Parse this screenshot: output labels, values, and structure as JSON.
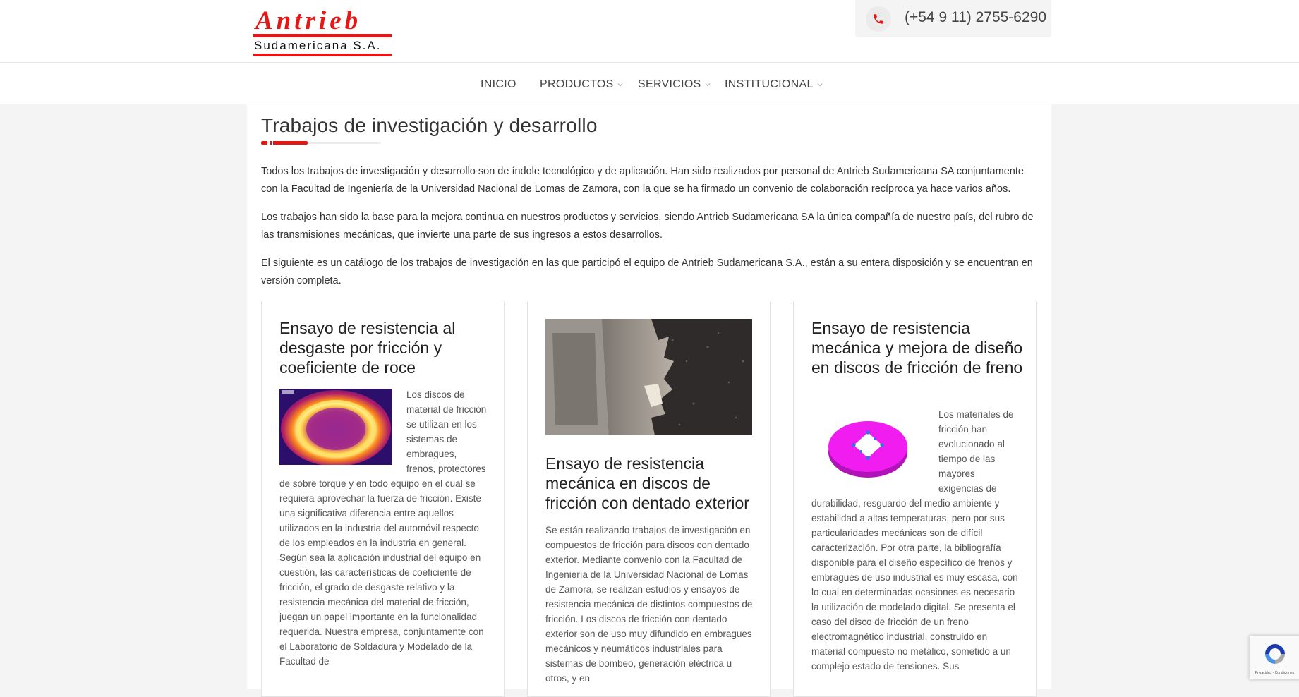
{
  "header": {
    "logo": {
      "brand": "Antrieb",
      "subtitle": "Sudamericana S.A."
    },
    "phone": "(+54 9 11) 2755-6290"
  },
  "nav": {
    "items": [
      {
        "label": "INICIO",
        "has_dropdown": false
      },
      {
        "label": "PRODUCTOS",
        "has_dropdown": true
      },
      {
        "label": "SERVICIOS",
        "has_dropdown": true
      },
      {
        "label": "INSTITUCIONAL",
        "has_dropdown": true
      }
    ]
  },
  "main": {
    "title": "Trabajos de investigación y desarrollo",
    "paragraphs": [
      "Todos los trabajos de investigación y desarrollo son de índole tecnológico y de aplicación. Han sido realizados por personal de Antrieb Sudamericana SA conjuntamente con la Facultad de Ingeniería de la Universidad Nacional de Lomas de Zamora, con la que se ha firmado un convenio de colaboración recíproca ya hace varios años.",
      "Los trabajos han sido la base para la mejora continua en nuestros productos y servicios, siendo Antrieb Sudamericana SA la única compañía de nuestro país, del rubro de las transmisiones mecánicas, que invierte una parte de sus ingresos a estos desarrollos.",
      "El siguiente es un catálogo de los trabajos de investigación en las que participó el equipo de Antrieb Sudamericana S.A., están a su entera disposición y se encuentran en versión completa."
    ],
    "cards": [
      {
        "title": "Ensayo de resistencia al desgaste por fricción y coeficiente de roce",
        "text": "Los discos de material de fricción se utilizan en los sistemas de embragues, frenos, protectores de sobre torque y en todo equipo en el cual se requiera aprovechar la fuerza de fricción. Existe una significativa diferencia entre aquellos utilizados en la industria del automóvil respecto de los empleados en la industria en general. Según sea la aplicación industrial del equipo en cuestión, las características de coeficiente de fricción, el grado de desgaste relativo y la resistencia mecánica del material de fricción, juegan un papel importante en la funcionalidad requerida. Nuestra empresa, conjuntamente con el Laboratorio de Soldadura y Modelado de la Facultad de"
      },
      {
        "title": "Ensayo de resistencia mecánica en discos de fricción con dentado exterior",
        "text": "Se están realizando trabajos de investigación en compuestos de fricción para discos con dentado exterior. Mediante convenio con la Facultad de Ingeniería de la Universidad Nacional de Lomas de Zamora, se realizan estudios y ensayos de resistencia mecánica de distintos compuestos de fricción. Los discos de fricción con dentado exterior son de uso muy difundido en embragues mecánicos y neumáticos industriales para sistemas de bombeo, generación eléctrica u otros, y en"
      },
      {
        "title": "Ensayo de resistencia mecánica y mejora de diseño en discos de fricción de freno",
        "text": "Los materiales de fricción han evolucionado al tiempo de las mayores exigencias de durabilidad, resguardo del medio ambiente y estabilidad a altas temperaturas, pero por sus particularidades mecánicas son de difícil caracterización. Por otra parte, la bibliografía disponible para el diseño específico de frenos y embragues de uso industrial es muy escasa, con lo cual en determinadas ocasiones es necesario la utilización de modelado digital. Se presenta el caso del disco de fricción de un freno electromagnético industrial, construido en material compuesto no metálico, sometido a un complejo estado de tensiones. Sus"
      }
    ]
  },
  "recaptcha": {
    "caption": "Privacidad - Condiciones"
  },
  "colors": {
    "accent": "#e41616",
    "text": "#333333",
    "muted": "#555555",
    "background": "#f4f4f4"
  }
}
